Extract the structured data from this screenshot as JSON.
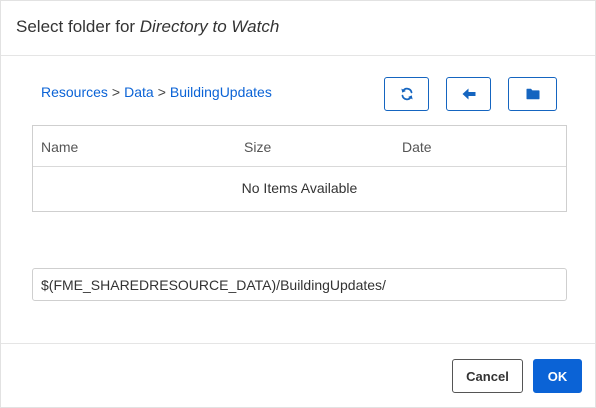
{
  "dialog": {
    "title_prefix": "Select folder for ",
    "title_target": "Directory to Watch"
  },
  "breadcrumb": {
    "items": [
      "Resources",
      "Data",
      "BuildingUpdates"
    ],
    "separator": ">"
  },
  "toolbar": {
    "refresh_icon": "refresh-icon",
    "back_icon": "arrow-left-icon",
    "folder_icon": "folder-icon"
  },
  "table": {
    "columns": [
      "Name",
      "Size",
      "Date"
    ],
    "empty_message": "No Items Available"
  },
  "path": {
    "value": "$(FME_SHAREDRESOURCE_DATA)/BuildingUpdates/"
  },
  "footer": {
    "cancel_label": "Cancel",
    "ok_label": "OK"
  },
  "colors": {
    "accent": "#0b63d6",
    "link": "#0b63d6",
    "border": "#cfcfcf"
  }
}
